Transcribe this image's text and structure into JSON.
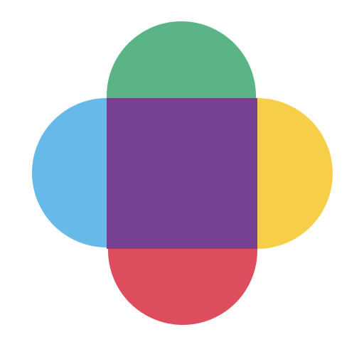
{
  "logo": {
    "colors": {
      "top": "#5bb486",
      "left": "#66b9e8",
      "right": "#f6ce47",
      "bottom": "#dd4d5d",
      "center": "#764093",
      "background": "#ffffff"
    }
  }
}
